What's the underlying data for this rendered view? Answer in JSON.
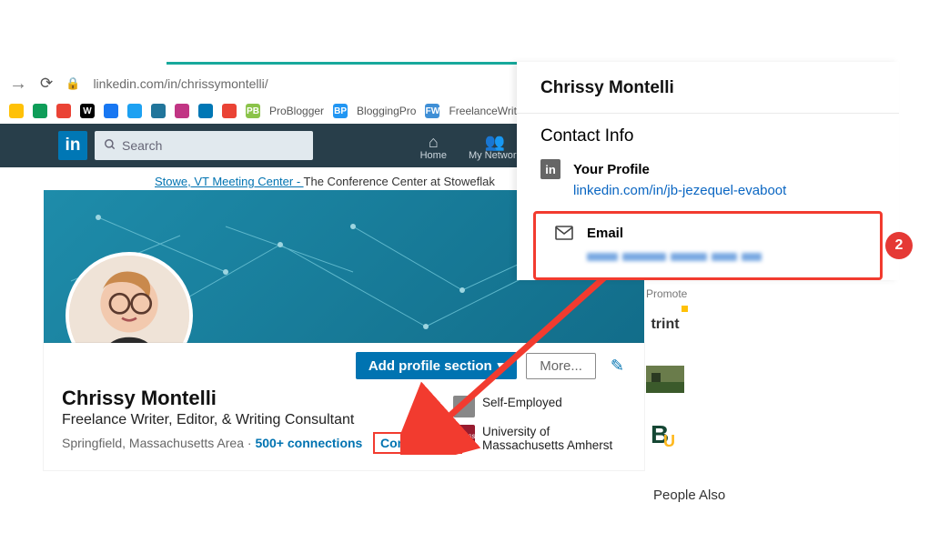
{
  "browser": {
    "url": "linkedin.com/in/chrissymontelli/",
    "bookmarks": [
      {
        "name": "google-drive",
        "color": "#ffc107"
      },
      {
        "name": "google-drive-2",
        "color": "#0f9d58"
      },
      {
        "name": "google-maps",
        "color": "#ea4335"
      },
      {
        "name": "wikipedia",
        "text": "W",
        "color": "#000"
      },
      {
        "name": "facebook",
        "color": "#1877f2"
      },
      {
        "name": "twitter",
        "color": "#1da1f2"
      },
      {
        "name": "wordpress",
        "color": "#21759b"
      },
      {
        "name": "instagram",
        "color": "#c13584"
      },
      {
        "name": "linkedin",
        "color": "#0077b5"
      },
      {
        "name": "gmail",
        "color": "#ea4335"
      }
    ],
    "text_bookmarks": [
      {
        "label": "ProBlogger",
        "badge": "PB",
        "badge_color": "#8bc34a"
      },
      {
        "label": "BloggingPro",
        "badge": "BP",
        "badge_color": "#2196f3"
      },
      {
        "label": "FreelanceWriting",
        "badge": "FW",
        "badge_color": "#3f8fd6"
      }
    ]
  },
  "linkedin_nav": {
    "search_placeholder": "Search",
    "items": [
      {
        "label": "Home",
        "icon": "⌂"
      },
      {
        "label": "My Network",
        "icon": "👥"
      }
    ]
  },
  "promo": {
    "blue": "Stowe, VT Meeting Center - ",
    "plain": "The Conference Center at Stoweflak"
  },
  "profile": {
    "name": "Chrissy Montelli",
    "headline": "Freelance Writer, Editor, & Writing Consultant",
    "location": "Springfield, Massachusetts Area",
    "connections": "500+ connections",
    "contact_info_label": "Contact info",
    "add_section_label": "Add profile section",
    "more_label": "More...",
    "employment": "Self-Employed",
    "school": "University of Massachusetts Amherst"
  },
  "sidebar": {
    "promote": "Promote",
    "ads": [
      {
        "l": "trint"
      }
    ],
    "also": "People Also"
  },
  "popup": {
    "name": "Chrissy Montelli",
    "title": "Contact Info",
    "your_profile_label": "Your Profile",
    "your_profile_url": "linkedin.com/in/jb-jezequel-evaboot",
    "email_label": "Email",
    "badge_num": "2"
  }
}
